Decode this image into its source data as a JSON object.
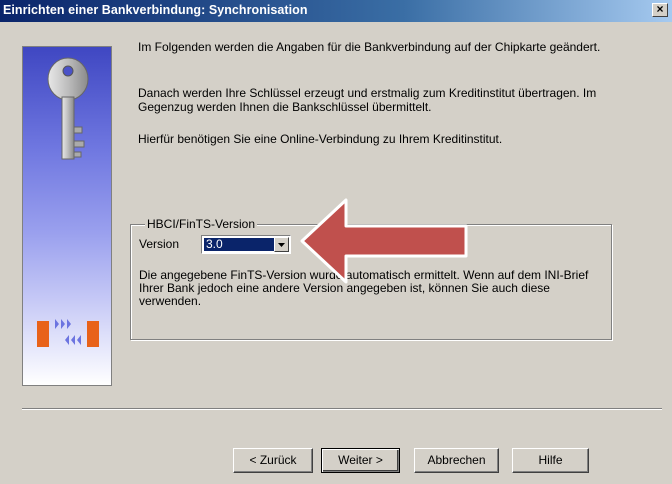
{
  "window": {
    "title": "Einrichten einer Bankverbindung: Synchronisation",
    "close_glyph": "×"
  },
  "intro": {
    "p1": "Im Folgenden werden die Angaben für die Bankverbindung auf der Chipkarte geändert.",
    "p2": "Danach werden Ihre Schlüssel erzeugt und erstmalig zum Kreditinstitut übertragen. Im Gegenzug werden Ihnen die Bankschlüssel übermittelt.",
    "p3": "Hierfür benötigen Sie eine Online-Verbindung zu Ihrem Kreditinstitut."
  },
  "group": {
    "legend": "HBCI/FinTS-Version",
    "version_label": "Version",
    "version_value": "3.0",
    "note": "Die angegebene FinTS-Version wurde automatisch ermittelt. Wenn auf dem INI-Brief Ihrer Bank jedoch eine andere Version angegeben ist, können Sie auch diese verwenden."
  },
  "buttons": {
    "back": "< Zurück",
    "next": "Weiter >",
    "cancel": "Abbrechen",
    "help": "Hilfe"
  },
  "colors": {
    "title_bar": "#0a246a",
    "annotation_arrow": "#c0504d",
    "selection": "#0a246a"
  },
  "icons": {
    "side_top": "key-icon",
    "side_bottom": "sync-arrows-icon",
    "combo": "chevron-down-icon"
  }
}
